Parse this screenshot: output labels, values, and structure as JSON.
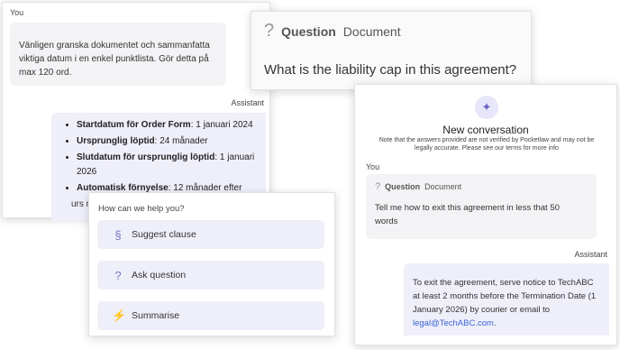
{
  "chat1": {
    "you_label": "You",
    "user_message": "Vänligen granska dokumentet och sammanfatta viktiga datum i en enkel punktlista. Gör detta på max 120 ord.",
    "assistant_label": "Assistant",
    "bullets": [
      {
        "key": "Startdatum för Order Form",
        "value": ": 1 januari 2024"
      },
      {
        "key": "Ursprunglig löptid",
        "value": ": 24 månader"
      },
      {
        "key": "Slutdatum för ursprunglig löptid",
        "value": ": 1 januari 2026"
      },
      {
        "key": "Automatisk förnyelse",
        "value": ": 12 månader efter"
      }
    ],
    "overflow_text": "urs mi"
  },
  "question_card": {
    "icon": "question-icon",
    "label": "Question",
    "doc": "Document",
    "text": "What is the liability cap in this agreement?"
  },
  "conversation": {
    "icon": "sparkle-icon",
    "title": "New conversation",
    "note": "Note that the answers provided are not verified by Pocketlaw and may not be legally accurate. Please see our terms for more info",
    "you_label": "You",
    "q_label": "Question",
    "q_doc": "Document",
    "user_message": "Tell me how to exit this agreement in less that 50 words",
    "assistant_label": "Assistant",
    "assistant_message": "To exit the agreement, serve notice to TechABC at least 2 months before the Termination Date (1 January 2026) by courier or email to",
    "email": "legal@TechABC.com",
    "email_suffix": "."
  },
  "help": {
    "header": "How can we help you?",
    "options": [
      {
        "icon": "section-icon",
        "glyph": "§",
        "label": "Suggest clause"
      },
      {
        "icon": "question-icon",
        "glyph": "?",
        "label": "Ask question"
      },
      {
        "icon": "lightning-icon",
        "glyph": "⚡",
        "label": "Summarise"
      }
    ]
  }
}
